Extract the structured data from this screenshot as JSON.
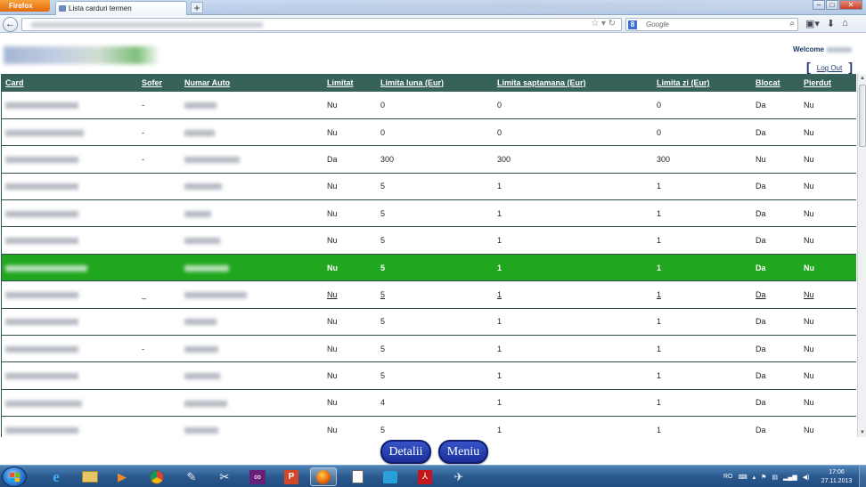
{
  "browser": {
    "app_button": "Firefox",
    "tab_title": "Lista carduri termen",
    "new_tab": "+",
    "search_placeholder": "Google",
    "search_engine_letter": "8"
  },
  "header": {
    "welcome": "Welcome",
    "logout": "Log Out"
  },
  "table": {
    "columns": [
      "Card",
      "Sofer",
      "Numar Auto",
      "Limitat",
      "Limita luna (Eur)",
      "Limita saptamana (Eur)",
      "Limita zi (Eur)",
      "Blocat",
      "Pierdut"
    ],
    "rows": [
      {
        "sofer": "-",
        "limitat": "Nu",
        "luna": "0",
        "saptamana": "0",
        "zi": "0",
        "blocat": "Da",
        "pierdut": "Nu"
      },
      {
        "sofer": "-",
        "limitat": "Nu",
        "luna": "0",
        "saptamana": "0",
        "zi": "0",
        "blocat": "Da",
        "pierdut": "Nu"
      },
      {
        "sofer": "-",
        "limitat": "Da",
        "luna": "300",
        "saptamana": "300",
        "zi": "300",
        "blocat": "Nu",
        "pierdut": "Nu"
      },
      {
        "sofer": "",
        "limitat": "Nu",
        "luna": "5",
        "saptamana": "1",
        "zi": "1",
        "blocat": "Da",
        "pierdut": "Nu"
      },
      {
        "sofer": "",
        "limitat": "Nu",
        "luna": "5",
        "saptamana": "1",
        "zi": "1",
        "blocat": "Da",
        "pierdut": "Nu"
      },
      {
        "sofer": "",
        "limitat": "Nu",
        "luna": "5",
        "saptamana": "1",
        "zi": "1",
        "blocat": "Da",
        "pierdut": "Nu"
      },
      {
        "sofer": "",
        "limitat": "Nu",
        "luna": "5",
        "saptamana": "1",
        "zi": "1",
        "blocat": "Da",
        "pierdut": "Nu"
      },
      {
        "sofer": "_",
        "limitat": "Nu",
        "luna": "5",
        "saptamana": "1",
        "zi": "1",
        "blocat": "Da",
        "pierdut": "Nu"
      },
      {
        "sofer": "",
        "limitat": "Nu",
        "luna": "5",
        "saptamana": "1",
        "zi": "1",
        "blocat": "Da",
        "pierdut": "Nu"
      },
      {
        "sofer": "-",
        "limitat": "Nu",
        "luna": "5",
        "saptamana": "1",
        "zi": "1",
        "blocat": "Da",
        "pierdut": "Nu"
      },
      {
        "sofer": "",
        "limitat": "Nu",
        "luna": "5",
        "saptamana": "1",
        "zi": "1",
        "blocat": "Da",
        "pierdut": "Nu"
      },
      {
        "sofer": "",
        "limitat": "Nu",
        "luna": "4",
        "saptamana": "1",
        "zi": "1",
        "blocat": "Da",
        "pierdut": "Nu"
      },
      {
        "sofer": "",
        "limitat": "Nu",
        "luna": "5",
        "saptamana": "1",
        "zi": "1",
        "blocat": "Da",
        "pierdut": "Nu"
      }
    ]
  },
  "buttons": {
    "detalii": "Detalii",
    "meniu": "Meniu"
  },
  "taskbar": {
    "language": "RO",
    "time": "17:06",
    "date": "27.11.2013"
  },
  "colors": {
    "header_bg": "#36625a",
    "selected_row": "#20a61f",
    "button_bg": "#1b2f9a"
  }
}
